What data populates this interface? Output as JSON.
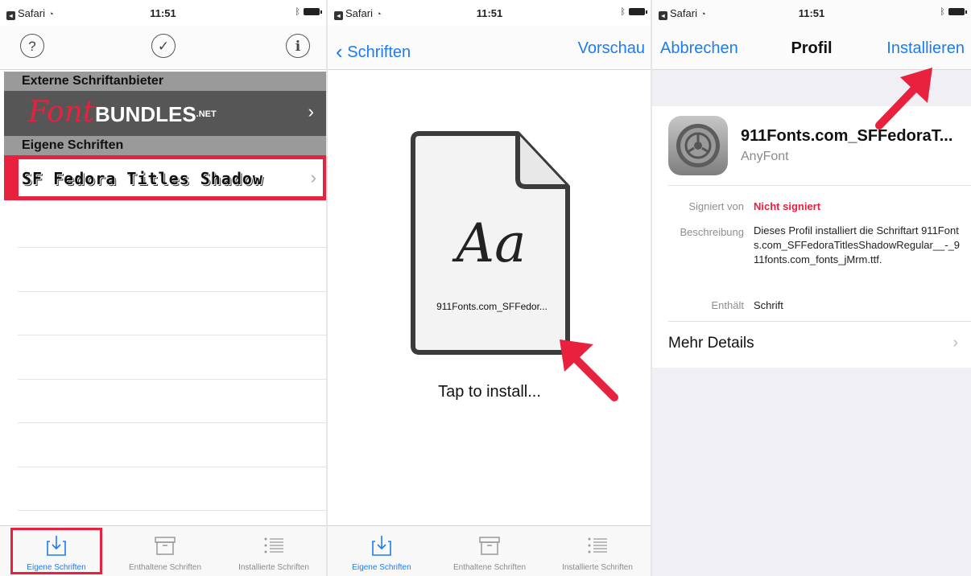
{
  "colors": {
    "accent": "#1a7cf5",
    "highlight": "#e8213e"
  },
  "panel1": {
    "status": {
      "carrier": "Safari",
      "time": "11:51"
    },
    "icons": [
      "help-circle-icon",
      "check-circle-icon",
      "info-circle-icon"
    ],
    "help_glyph": "?",
    "check_glyph": "✓",
    "info_glyph": "i",
    "section_external": "Externe Schriftanbieter",
    "fontbundles": {
      "script": "Font",
      "bold": "BUNDLES",
      "suffix": ".NET"
    },
    "section_own": "Eigene Schriften",
    "font_item": "SF Fedora Titles Shadow",
    "tabs": [
      "Eigene Schriften",
      "Enthaltene Schriften",
      "Installierte Schriften"
    ]
  },
  "panel2": {
    "status": {
      "carrier": "Safari",
      "time": "11:51"
    },
    "back_label": "Schriften",
    "preview_label": "Vorschau",
    "doc_glyph": "Aa",
    "doc_name": "911Fonts.com_SFFedor...",
    "caption": "Tap to install...",
    "tabs": [
      "Eigene Schriften",
      "Enthaltene Schriften",
      "Installierte Schriften"
    ]
  },
  "panel3": {
    "status": {
      "carrier": "Safari",
      "time": "11:51"
    },
    "cancel_label": "Abbrechen",
    "title": "Profil",
    "install_label": "Installieren",
    "profile_name": "911Fonts.com_SFFedoraT...",
    "profile_sub": "AnyFont",
    "signed_key": "Signiert von",
    "signed_val": "Nicht signiert",
    "desc_key": "Beschreibung",
    "desc_val": "Dieses Profil installiert die Schriftart 911Fonts.com_SFFedoraTitlesShadowRegular__-_911fonts.com_fonts_jMrm.ttf.",
    "contains_key": "Enthält",
    "contains_val": "Schrift",
    "more_details": "Mehr Details"
  }
}
